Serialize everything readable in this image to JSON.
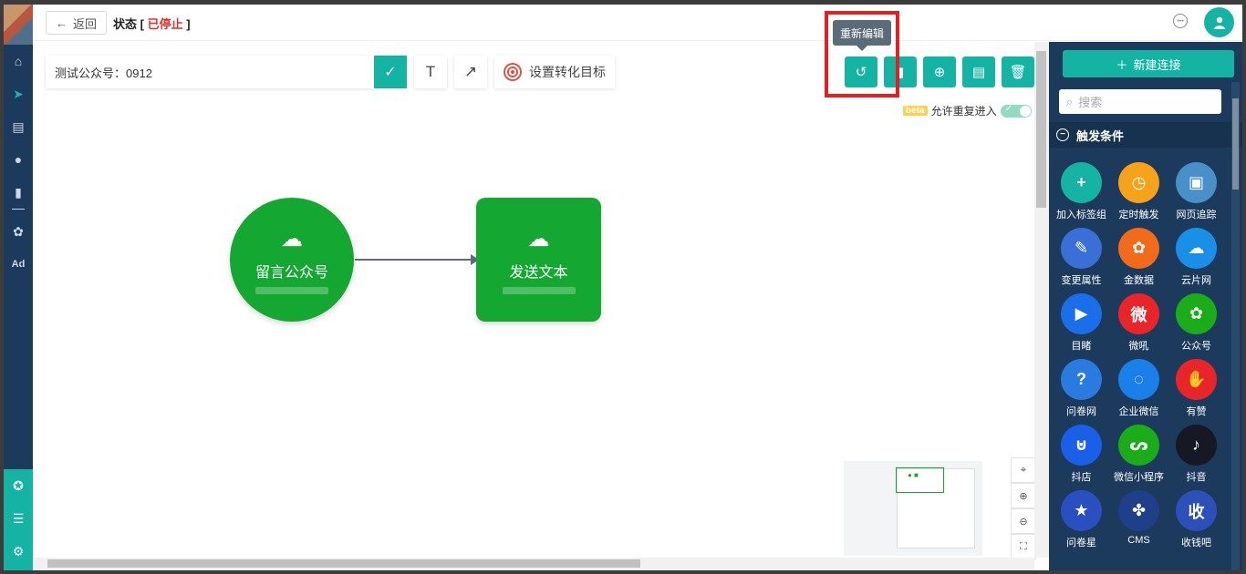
{
  "header": {
    "back_label": "返回",
    "status_prefix": "状态 [",
    "status_value": "已停止",
    "status_suffix": "]"
  },
  "toolbar": {
    "name_value": "测试公众号：0912",
    "text_tool": "T",
    "arrow_tool": "↗",
    "goal_label": "设置转化目标"
  },
  "actions": {
    "tooltip": "重新编辑"
  },
  "reentry": {
    "beta": "beta",
    "label": "允许重复进入",
    "enabled": true
  },
  "nodes": [
    {
      "label": "留言公众号"
    },
    {
      "label": "发送文本"
    }
  ],
  "right_panel": {
    "new_connection": "新建连接",
    "search_placeholder": "搜索",
    "section_title": "触发条件",
    "items": [
      {
        "label": "加入标签组",
        "color": "#14b3a4"
      },
      {
        "label": "定时触发",
        "color": "#f7a21b"
      },
      {
        "label": "网页追踪",
        "color": "#4a90c8"
      },
      {
        "label": "变更属性",
        "color": "#3a6fd8"
      },
      {
        "label": "金数据",
        "color": "#f26a1b"
      },
      {
        "label": "云片网",
        "color": "#1a8fe8"
      },
      {
        "label": "目睹",
        "color": "#1a6fe8"
      },
      {
        "label": "微吼",
        "color": "#e8262a"
      },
      {
        "label": "公众号",
        "color": "#1aad19"
      },
      {
        "label": "问卷网",
        "color": "#2a7be0"
      },
      {
        "label": "企业微信",
        "color": "#1a7fe8"
      },
      {
        "label": "有赞",
        "color": "#e8262a"
      },
      {
        "label": "抖店",
        "color": "#1a5fe8"
      },
      {
        "label": "微信小程序",
        "color": "#1aad19"
      },
      {
        "label": "抖音",
        "color": "#161823"
      },
      {
        "label": "问卷星",
        "color": "#2a4fc0"
      },
      {
        "label": "CMS",
        "color": "#1f3f8a"
      },
      {
        "label": "收钱吧",
        "color": "#2d4fb8"
      }
    ]
  }
}
